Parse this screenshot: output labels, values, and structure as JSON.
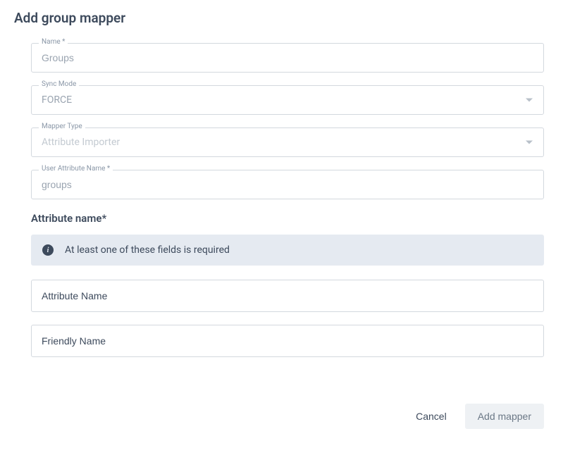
{
  "title": "Add group mapper",
  "fields": {
    "name": {
      "label": "Name *",
      "value": "Groups"
    },
    "syncMode": {
      "label": "Sync Mode",
      "value": "FORCE"
    },
    "mapperType": {
      "label": "Mapper Type",
      "value": "Attribute Importer"
    },
    "userAttributeName": {
      "label": "User Attribute Name *",
      "value": "groups"
    }
  },
  "attributeSection": {
    "label": "Attribute name*",
    "info": "At least one of these fields is required",
    "attributeName": {
      "placeholder": "Attribute Name"
    },
    "friendlyName": {
      "placeholder": "Friendly Name"
    }
  },
  "actions": {
    "cancel": "Cancel",
    "submit": "Add mapper"
  }
}
